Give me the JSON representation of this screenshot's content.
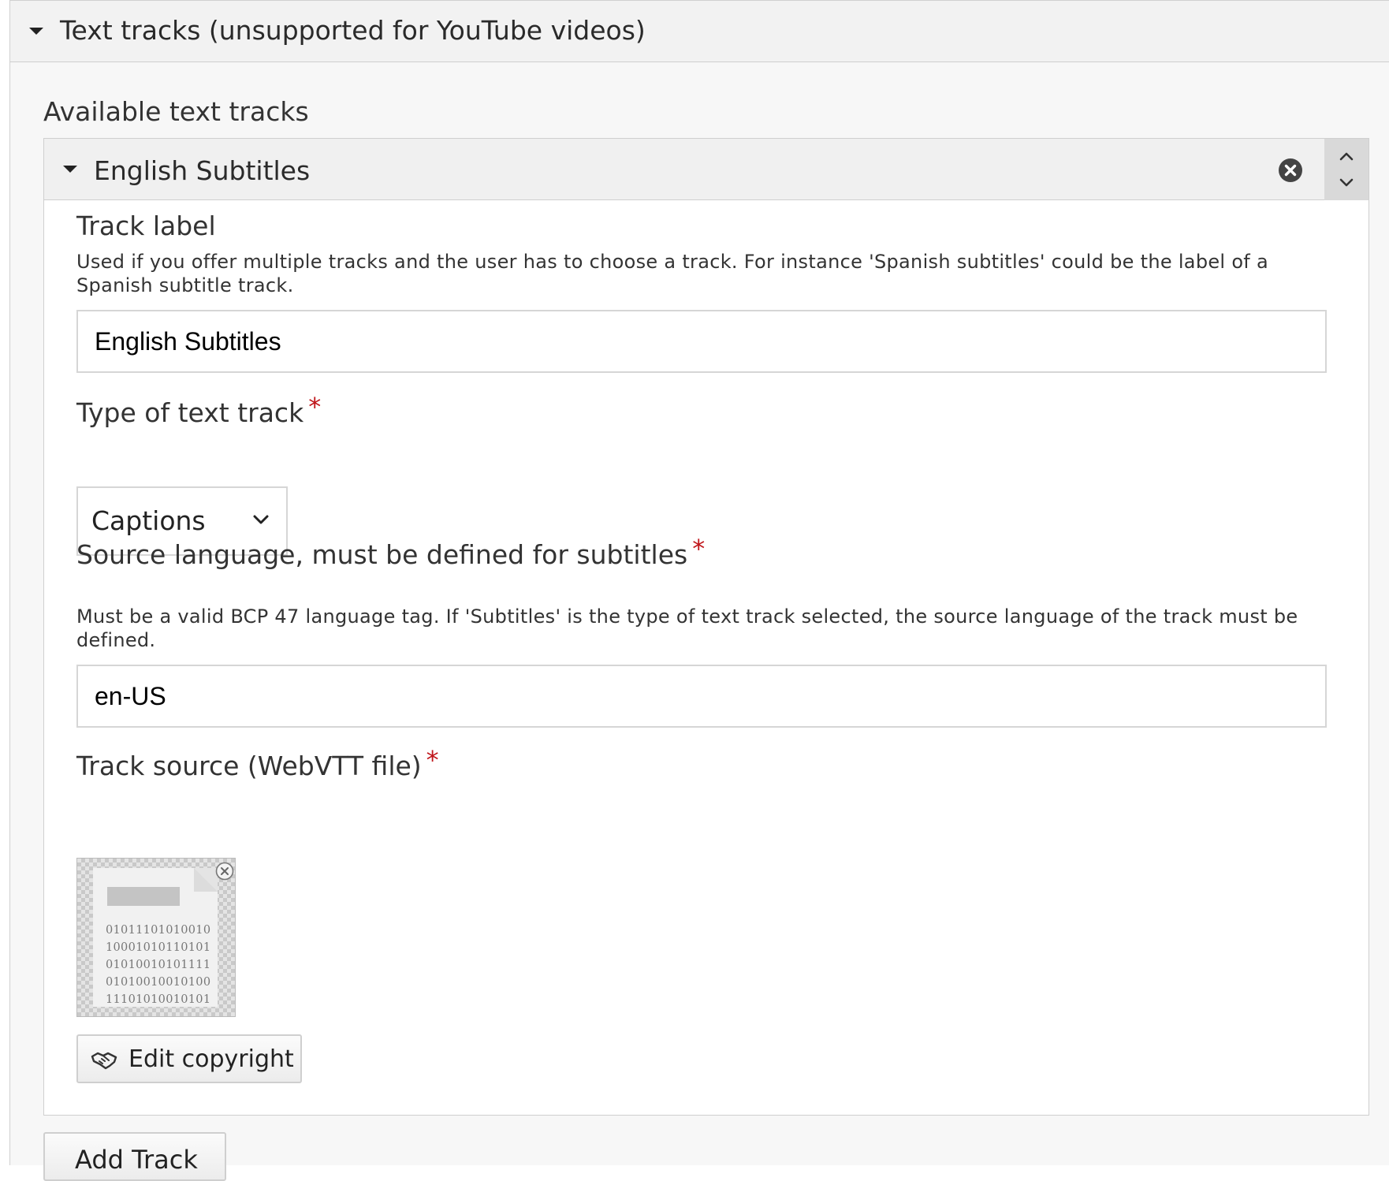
{
  "outer": {
    "title": "Text tracks (unsupported for YouTube videos)"
  },
  "available_label": "Available text tracks",
  "track": {
    "title": "English Subtitles",
    "label_field": {
      "label": "Track label",
      "description": "Used if you offer multiple tracks and the user has to choose a track. For instance 'Spanish subtitles' could be the label of a Spanish subtitle track.",
      "value": "English Subtitles"
    },
    "type_field": {
      "label": "Type of text track",
      "required": "*",
      "value": "Captions"
    },
    "lang_field": {
      "label": "Source language, must be defined for subtitles",
      "required": "*",
      "description": "Must be a valid BCP 47 language tag. If 'Subtitles' is the type of text track selected, the source language of the track must be defined.",
      "value": "en-US"
    },
    "source_field": {
      "label": "Track source (WebVTT file)",
      "required": "*"
    },
    "copyright_button": "Edit copyright"
  },
  "add_button": "Add Track",
  "icons": {
    "caret": "caret-down-icon",
    "remove": "remove-circle-icon",
    "up": "chevron-up-icon",
    "down": "chevron-down-icon",
    "file": "file-thumbnail-icon",
    "copyright": "handshake-icon"
  }
}
